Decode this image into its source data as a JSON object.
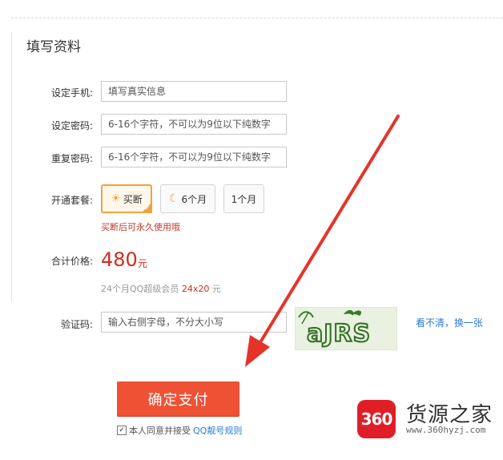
{
  "section": {
    "title": "填写资料"
  },
  "form": {
    "phone": {
      "label": "设定手机:",
      "placeholder": "填写真实信息"
    },
    "password": {
      "label": "设定密码:",
      "placeholder": "6-16个字符，不可以为9位以下纯数字"
    },
    "password_repeat": {
      "label": "重复密码:",
      "placeholder": "6-16个字符，不可以为9位以下纯数字"
    },
    "package": {
      "label": "开通套餐:",
      "options": [
        {
          "label": "买断",
          "icon": "sun-icon",
          "selected": true
        },
        {
          "label": "6个月",
          "icon": "moon-icon",
          "selected": false
        },
        {
          "label": "1个月",
          "icon": "",
          "selected": false
        }
      ],
      "hint": "买断后可永久使用哦"
    },
    "price": {
      "label": "合计价格:",
      "amount": "480",
      "unit": "元",
      "detail_prefix": "24个月QQ超级会员",
      "detail_formula": "24x20",
      "detail_suffix": "元"
    },
    "captcha": {
      "label": "验证码:",
      "placeholder": "输入右侧字母，不分大小写",
      "image_text": "aJRS",
      "refresh_link": "看不清，换一张"
    },
    "confirm_button": "确定支付",
    "agreement": {
      "checked": true,
      "prefix": "本人同意并接受",
      "link": "QQ靓号规则"
    }
  },
  "watermark": {
    "logo_text": "360",
    "name": "货源之家",
    "url": "www.360hyzj.com"
  },
  "colors": {
    "accent": "#ef5134",
    "price": "#d22c1d",
    "link": "#2c7bd3",
    "selected_border": "#f2a23c",
    "arrow": "#e5332a"
  }
}
